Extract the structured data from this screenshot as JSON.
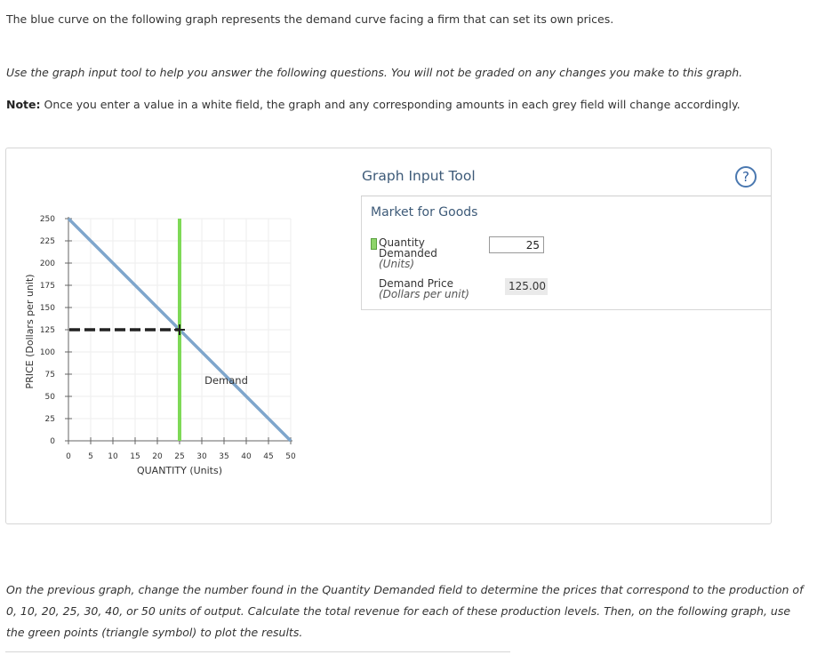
{
  "text": {
    "intro": "The blue curve on the following graph represents the demand curve facing a firm that can set its own prices.",
    "instruction": "Use the graph input tool to help you answer the following questions. You will not be graded on any changes you make to this graph.",
    "note_label": "Note:",
    "note_body": " Once you enter a value in a white field, the graph and any corresponding amounts in each grey field will change accordingly.",
    "outro": "On the previous graph, change the number found in the Quantity Demanded field to determine the prices that correspond to the production of 0, 10, 20, 25, 30, 40, or 50 units of output. Calculate the total revenue for each of these production levels. Then, on the following graph, use the green points (triangle symbol) to plot the results."
  },
  "graph_input_tool": {
    "title": "Graph Input Tool",
    "help_symbol": "?",
    "market_title": "Market for Goods",
    "quantity_label_line1": "Quantity",
    "quantity_label_line2": "Demanded",
    "quantity_unit": "(Units)",
    "quantity_value": "25",
    "price_label": "Demand Price",
    "price_unit": "(Dollars per unit)",
    "price_value": "125.00"
  },
  "chart_data": {
    "type": "line",
    "xlabel": "QUANTITY (Units)",
    "ylabel": "PRICE (Dollars per unit)",
    "xlim": [
      0,
      50
    ],
    "ylim": [
      0,
      250
    ],
    "xticks": [
      0,
      5,
      10,
      15,
      20,
      25,
      30,
      35,
      40,
      45,
      50
    ],
    "yticks": [
      0,
      25,
      50,
      75,
      100,
      125,
      150,
      175,
      200,
      225,
      250
    ],
    "grid": true,
    "series": [
      {
        "name": "Demand",
        "points": [
          [
            0,
            250
          ],
          [
            50,
            0
          ]
        ],
        "color": "#7fa6cc"
      }
    ],
    "selected_quantity": 25,
    "selected_price": 125,
    "quantity_line_color": "#7ed957",
    "price_dash_color": "#222222"
  }
}
